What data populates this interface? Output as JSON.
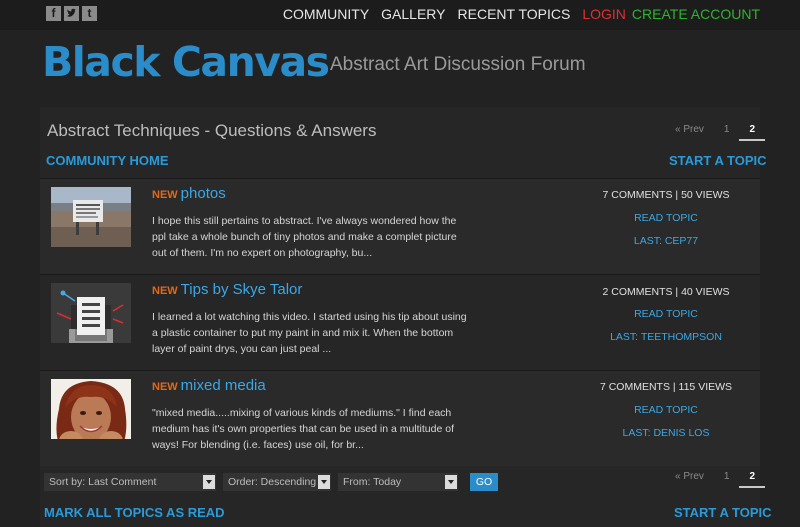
{
  "social": {
    "facebook_glyph": "f",
    "twitter_icon": "twitter-icon",
    "tumblr_glyph": "t"
  },
  "topnav": {
    "items": [
      "COMMUNITY",
      "GALLERY",
      "RECENT TOPICS"
    ],
    "login": "LOGIN",
    "create": "CREATE ACCOUNT"
  },
  "header": {
    "logo": "Black Canvas",
    "tagline": "Abstract Art Discussion Forum"
  },
  "forum": {
    "title": "Abstract Techniques - Questions & Answers",
    "community_home": "COMMUNITY HOME",
    "start_topic": "START A TOPIC",
    "mark_all": "MARK ALL TOPICS AS READ"
  },
  "pager": {
    "prev": "« Prev",
    "pages": [
      "1",
      "2"
    ],
    "current": "2"
  },
  "topics": [
    {
      "new_label": "NEW",
      "title": "photos",
      "excerpt": "I hope this still pertains to abstract. I've always wondered how the ppl take a whole bunch of tiny photos and make a complet picture out of them. I'm no expert on photography, bu...",
      "stats": "7 COMMENTS | 50 VIEWS",
      "read": "READ TOPIC",
      "last": "LAST: CEP77"
    },
    {
      "new_label": "NEW",
      "title": "Tips by Skye Talor",
      "excerpt": "I learned a lot watching this video. I started using his tip about using a plastic container to put my paint in and mix it. When the bottom layer of paint drys, you can just peal ...",
      "stats": "2 COMMENTS | 40 VIEWS",
      "read": "READ TOPIC",
      "last": "LAST: TEETHOMPSON"
    },
    {
      "new_label": "NEW",
      "title": "mixed media",
      "excerpt": "\"mixed media.....mixing of various kinds of mediums.\" I find each medium has it's own properties that can be used in a multitude of ways! For blending (i.e. faces) use oil, for br...",
      "stats": "7 COMMENTS | 115 VIEWS",
      "read": "READ TOPIC",
      "last": "LAST: DENIS LOS"
    }
  ],
  "filters": {
    "sort": "Sort by: Last Comment",
    "order": "Order: Descending",
    "from": "From: Today",
    "go": "GO"
  },
  "colors": {
    "background": "#222222",
    "accent": "#2a8cc8",
    "link": "#3aa8e6",
    "new": "#e06a1a",
    "login": "#e03030",
    "create": "#2fb32f"
  }
}
